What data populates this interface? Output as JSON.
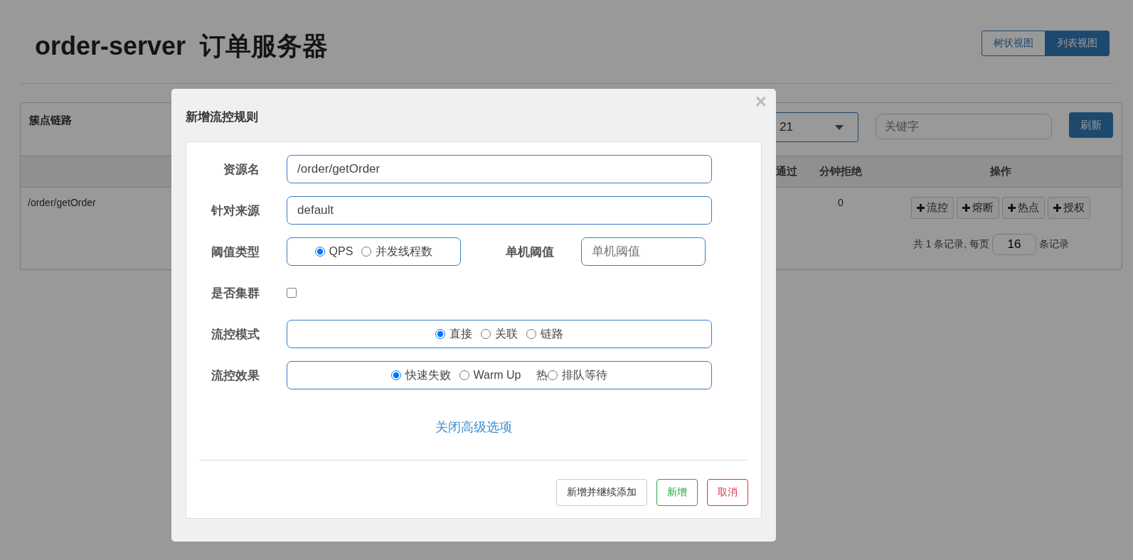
{
  "header": {
    "title": "order-server  订单服务器",
    "view_toggle": [
      {
        "label": "树状视图",
        "selected": false
      },
      {
        "label": "列表视图",
        "selected": true
      }
    ]
  },
  "panel": {
    "title": "簇点链路",
    "machine_select": {
      "value": "21"
    },
    "search": {
      "placeholder": "关键字"
    },
    "refresh_button": "刷新",
    "table": {
      "columns": [
        "通过",
        "分钟拒绝",
        "操作"
      ],
      "rows": [
        {
          "resource": "/order/getOrder",
          "column_3": "0",
          "actions": [
            "流控",
            "熔断",
            "热点",
            "授权"
          ]
        }
      ]
    },
    "pagination": {
      "prefix": "共 1 条记录, 每页",
      "page_size": "16",
      "suffix": "条记录"
    }
  },
  "modal": {
    "title": "新增流控规则",
    "close": "×",
    "fields": [
      {
        "kind": "text",
        "label": "资源名",
        "value": "/order/getOrder"
      },
      {
        "kind": "text",
        "label": "针对来源",
        "value": "default"
      },
      {
        "kind": "radio_input",
        "label": "阈值类型",
        "options": [
          {
            "label": "QPS",
            "selected": true
          },
          {
            "label": "并发线程数",
            "selected": false
          }
        ],
        "input_label": "单机阈值",
        "placeholder": "单机阈值"
      },
      {
        "kind": "checkbox",
        "label": "是否集群",
        "checked": false
      },
      {
        "kind": "radio",
        "label": "流控模式",
        "options": [
          {
            "label": "直接",
            "selected": true
          },
          {
            "label": "关联",
            "selected": false
          },
          {
            "label": "链路",
            "selected": false
          }
        ]
      },
      {
        "kind": "radio",
        "label": "流控效果",
        "options": [
          {
            "label": "快速失败",
            "selected": true
          },
          {
            "label": "Warm Up",
            "selected": false
          },
          {
            "label": "排队等待",
            "selected": false,
            "prefix": "热"
          }
        ]
      }
    ],
    "advanced_link": "关闭高级选项",
    "buttons": [
      {
        "label": "新增并继续添加",
        "kind": "default"
      },
      {
        "label": "新增",
        "kind": "success"
      },
      {
        "label": "取消",
        "kind": "danger"
      }
    ]
  }
}
